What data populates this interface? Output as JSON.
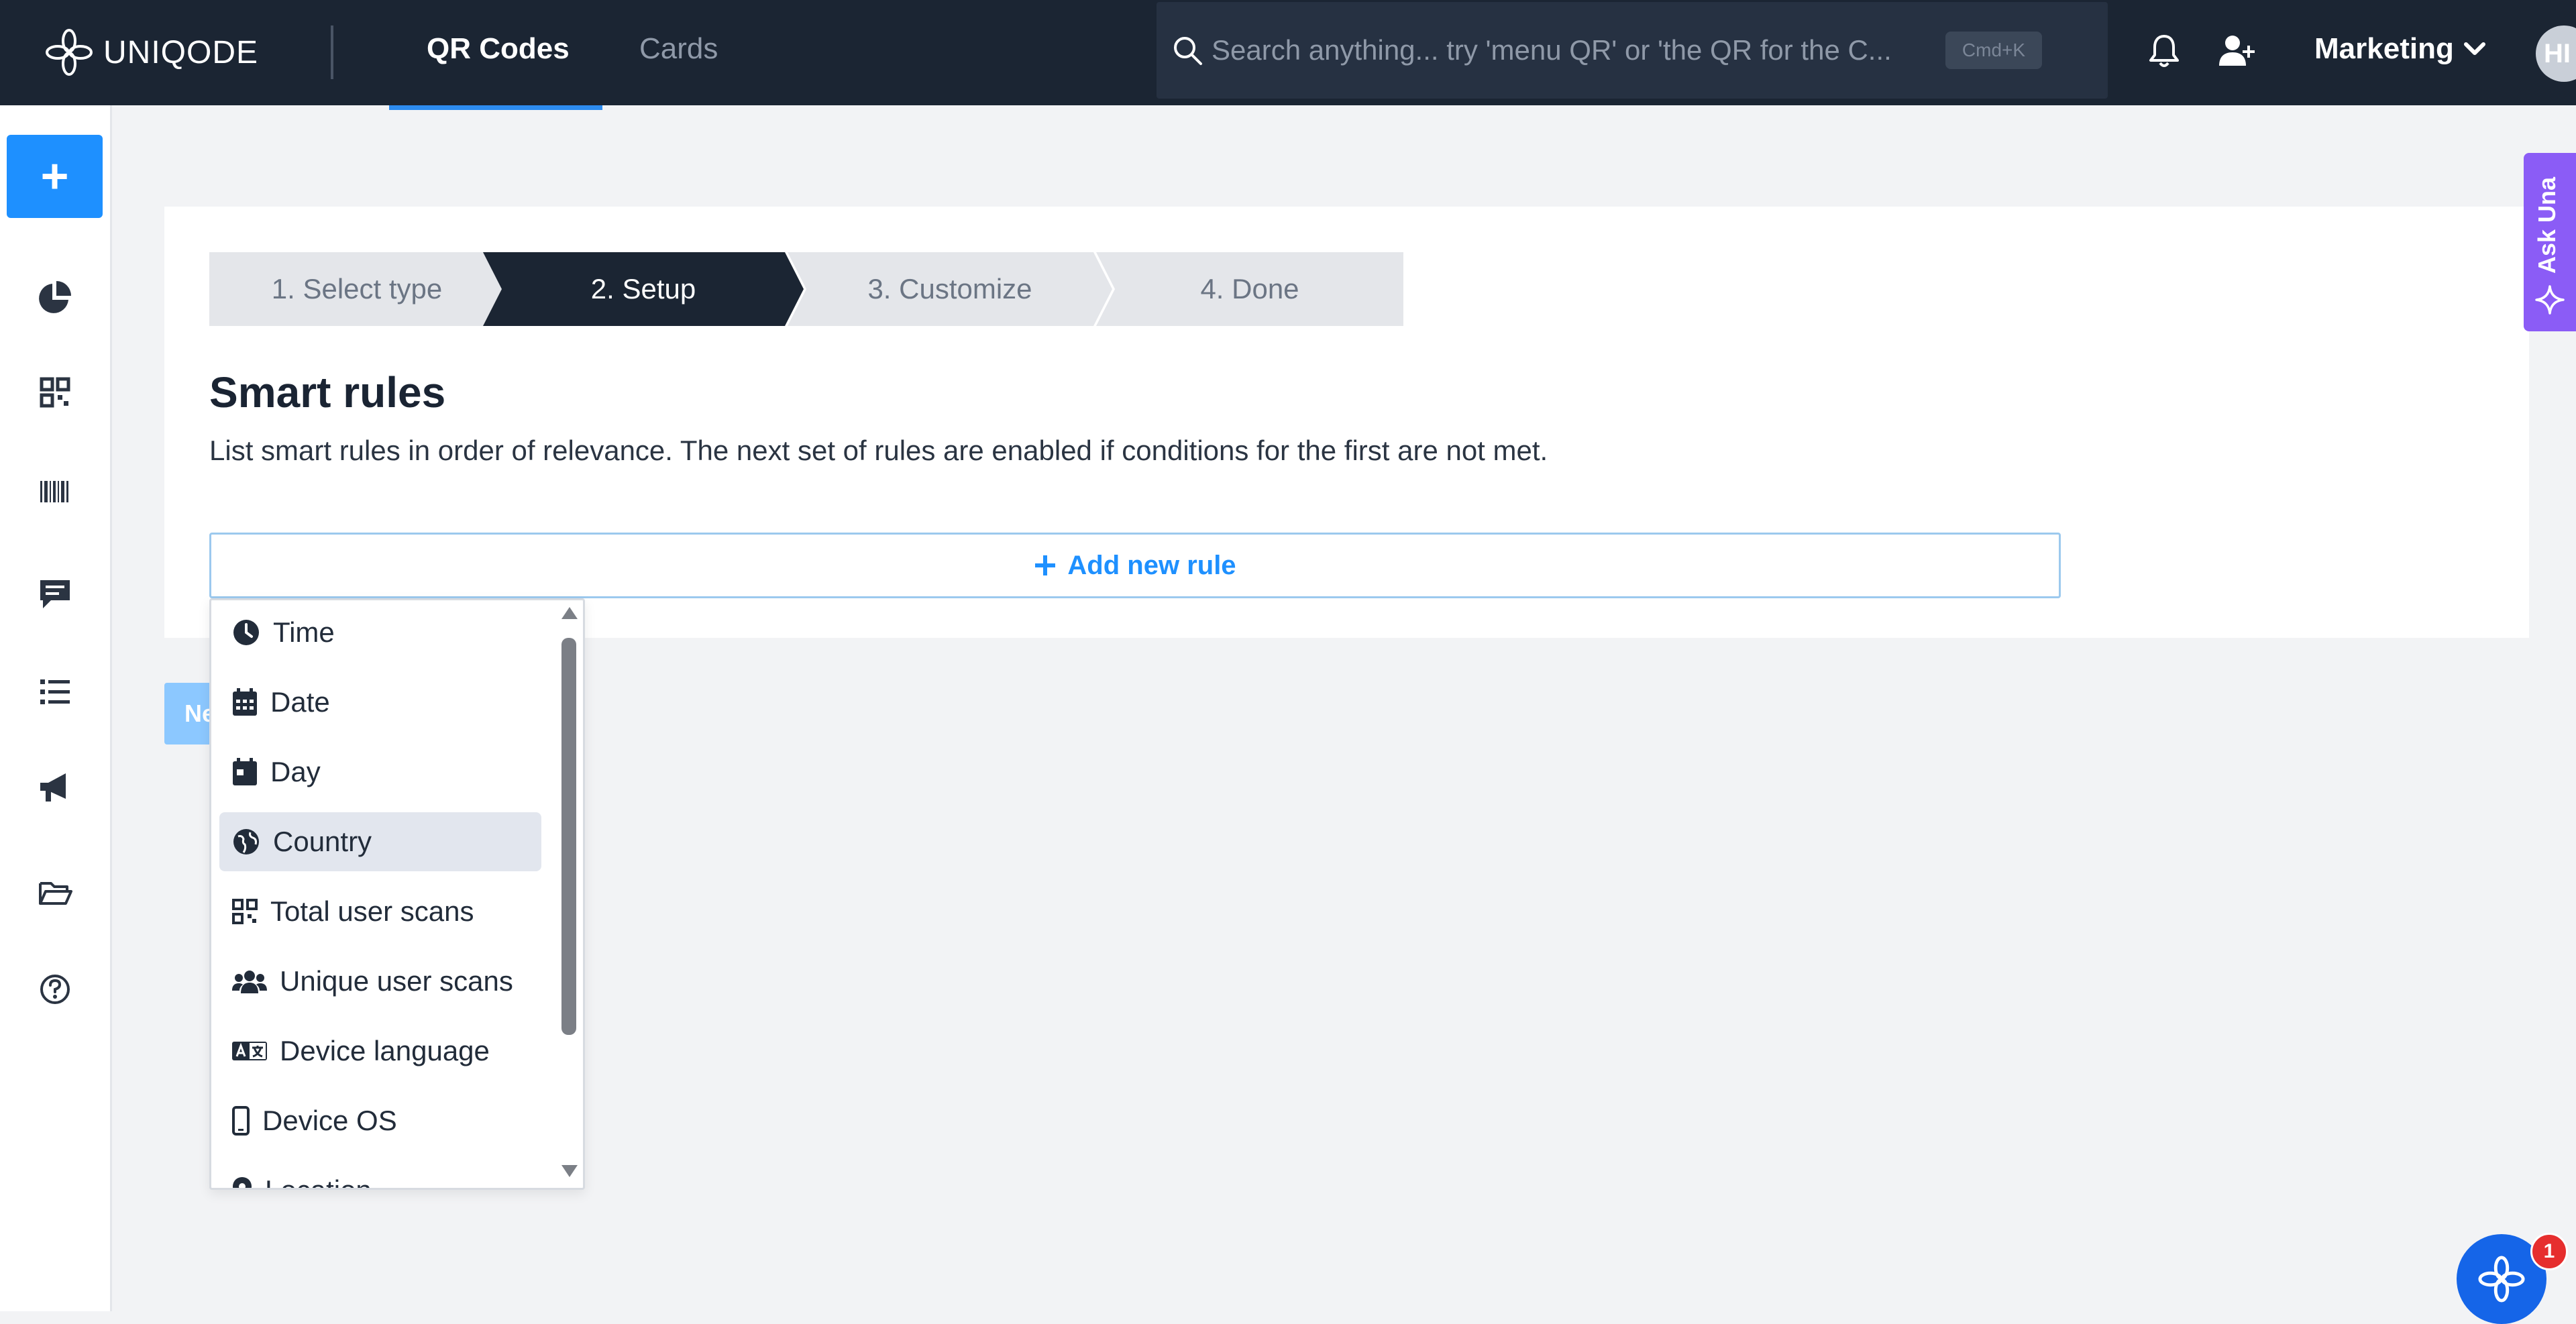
{
  "brand": {
    "name": "UNIQODE"
  },
  "nav": {
    "tabs": [
      {
        "label": "QR Codes",
        "active": true
      },
      {
        "label": "Cards",
        "active": false
      }
    ]
  },
  "search": {
    "placeholder": "Search anything... try 'menu QR' or 'the QR for the C...",
    "shortcut": "Cmd+K"
  },
  "header": {
    "workspace": "Marketing",
    "avatar_initials": "HI"
  },
  "sidebar": {
    "create_label": "+",
    "items": [
      "analytics-icon",
      "qr-codes-icon",
      "barcodes-icon",
      "forms-icon",
      "list-icon",
      "campaigns-icon",
      "folder-icon",
      "help-icon"
    ]
  },
  "wizard": {
    "steps": [
      {
        "label": "1. Select type",
        "active": false
      },
      {
        "label": "2. Setup",
        "active": true
      },
      {
        "label": "3. Customize",
        "active": false
      },
      {
        "label": "4. Done",
        "active": false
      }
    ]
  },
  "smart_rules": {
    "title": "Smart rules",
    "description": "List smart rules in order of relevance. The next set of rules are enabled if conditions for the first are not met.",
    "add_rule_label": "Add new rule",
    "next_button_label": "Ne"
  },
  "rule_menu": {
    "selected": "Country",
    "options": [
      {
        "label": "Time",
        "icon": "clock-icon"
      },
      {
        "label": "Date",
        "icon": "calendar-icon"
      },
      {
        "label": "Day",
        "icon": "calendar-day-icon"
      },
      {
        "label": "Country",
        "icon": "globe-icon"
      },
      {
        "label": "Total user scans",
        "icon": "qr-icon"
      },
      {
        "label": "Unique user scans",
        "icon": "users-icon"
      },
      {
        "label": "Device language",
        "icon": "language-icon"
      },
      {
        "label": "Device OS",
        "icon": "mobile-icon"
      },
      {
        "label": "Location",
        "icon": "location-icon"
      }
    ]
  },
  "widgets": {
    "ask_una_label": "Ask Una",
    "chat_badge": "1"
  },
  "colors": {
    "topbar": "#1b2533",
    "accent": "#1e90ff",
    "ask_una": "#8b5cf6",
    "badge": "#e62e2e"
  }
}
